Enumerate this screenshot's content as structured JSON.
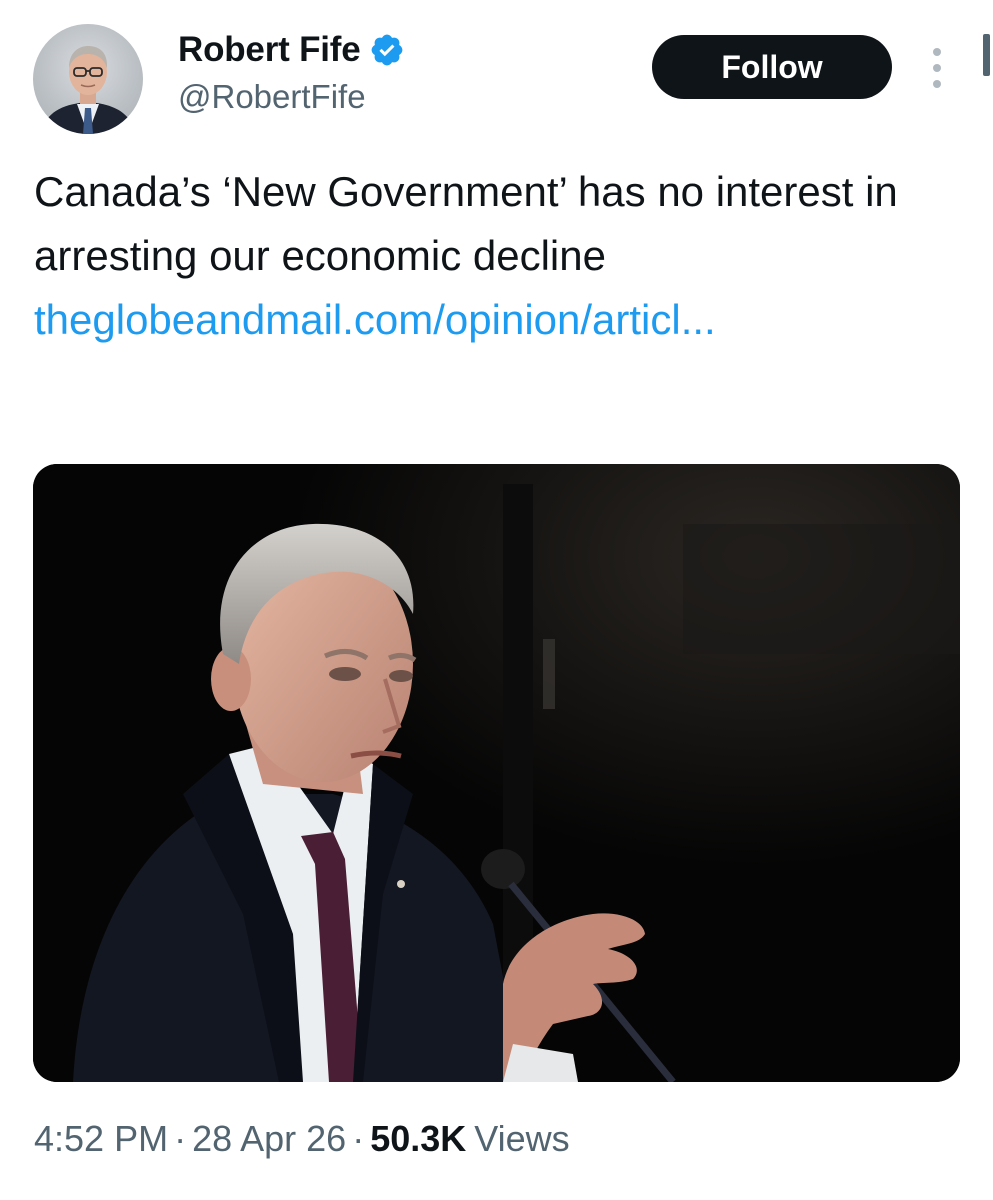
{
  "author": {
    "display_name": "Robert Fife",
    "handle": "@RobertFife",
    "verified": true,
    "verified_color": "#1d9bf0"
  },
  "actions": {
    "follow_label": "Follow",
    "more_icon": "more-vertical-icon"
  },
  "tweet": {
    "text": "Canada’s ‘New Government’ has no interest in arresting our economic decline",
    "link_text": "theglobeandmail.com/opinion/articl...",
    "link_color": "#1d9bf0"
  },
  "meta": {
    "time": "4:52 PM",
    "separator": "·",
    "date": "28 Apr 26",
    "views_count": "50.3K",
    "views_label": "Views"
  }
}
